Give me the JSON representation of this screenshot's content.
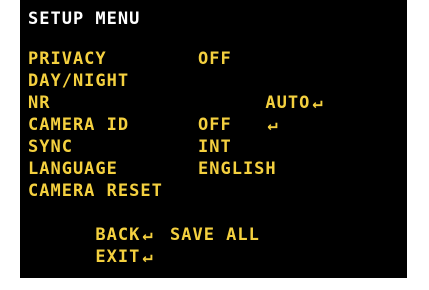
{
  "menu": {
    "title": "SETUP MENU",
    "items": [
      {
        "label": "PRIVACY",
        "value": "OFF",
        "submenu": false
      },
      {
        "label": "DAY/NIGHT",
        "value": "AUTO",
        "submenu": true
      },
      {
        "label": "NR",
        "value": "",
        "submenu": true
      },
      {
        "label": "CAMERA ID",
        "value": "OFF",
        "submenu": false
      },
      {
        "label": "SYNC",
        "value": "INT",
        "submenu": false
      },
      {
        "label": "LANGUAGE",
        "value": "ENGLISH",
        "submenu": false
      },
      {
        "label": "CAMERA RESET",
        "value": "",
        "submenu": false
      },
      {
        "label": "BACK",
        "value": "",
        "submenu": true
      },
      {
        "label": "EXIT",
        "value": "",
        "submenu": true
      }
    ],
    "save_all": "SAVE ALL",
    "enter_symbol": "↵"
  },
  "colors": {
    "background": "#000000",
    "title": "#ffffff",
    "items": "#f4d03f"
  }
}
